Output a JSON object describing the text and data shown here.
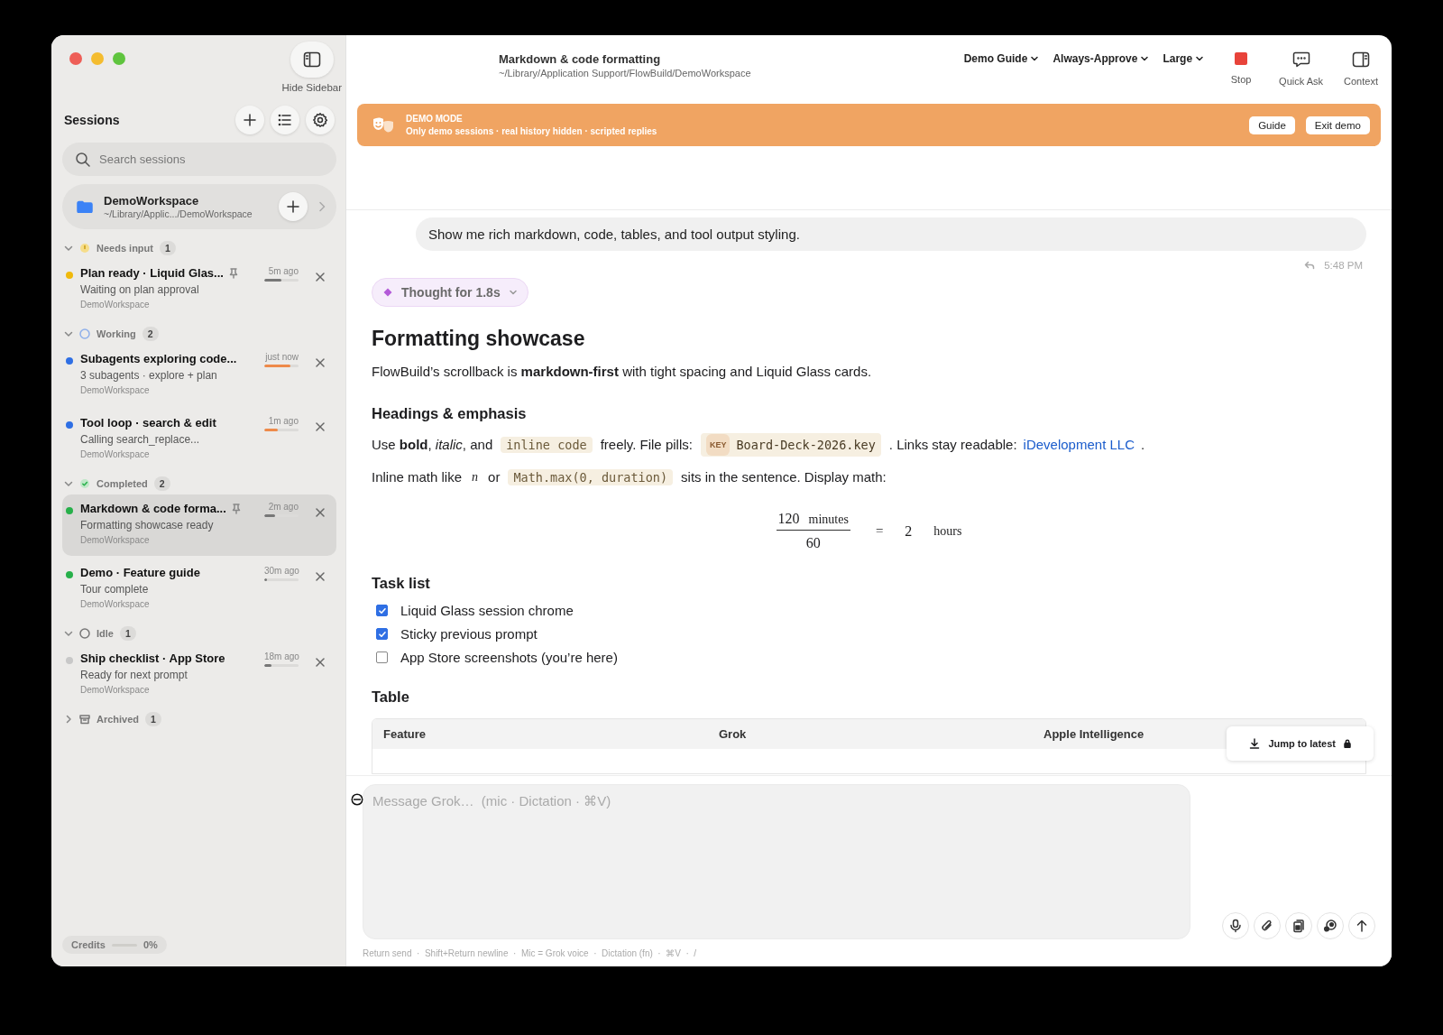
{
  "sidebar": {
    "hide_button": {
      "label": "Hide Sidebar"
    },
    "title": "Sessions",
    "search": {
      "placeholder": "Search sessions"
    },
    "workspace": {
      "name": "DemoWorkspace",
      "path": "~/Library/Applic.../DemoWorkspace"
    },
    "groups": [
      {
        "kind": "needs_input",
        "label": "Needs input",
        "count": "1",
        "expanded": true,
        "items": [
          {
            "title": "Plan ready · Liquid Glas...",
            "pinned": true,
            "subtitle": "Waiting on plan approval",
            "workspace": "DemoWorkspace",
            "time": "5m ago",
            "level": 0.5,
            "color": "#f0b90b",
            "selected": false
          }
        ]
      },
      {
        "kind": "working",
        "label": "Working",
        "count": "2",
        "expanded": true,
        "items": [
          {
            "title": "Subagents exploring code...",
            "pinned": false,
            "subtitle": "3 subagents · explore + plan",
            "workspace": "DemoWorkspace",
            "time": "just now",
            "level": 0.75,
            "color": "#2f6fe4",
            "selected": false
          },
          {
            "title": "Tool loop · search & edit",
            "pinned": false,
            "subtitle": "Calling search_replace...",
            "workspace": "DemoWorkspace",
            "time": "1m ago",
            "level": 0.4,
            "color": "#2f6fe4",
            "selected": false
          }
        ]
      },
      {
        "kind": "completed",
        "label": "Completed",
        "count": "2",
        "expanded": true,
        "items": [
          {
            "title": "Markdown & code forma...",
            "pinned": true,
            "subtitle": "Formatting showcase ready",
            "workspace": "DemoWorkspace",
            "time": "2m ago",
            "level": 0.32,
            "color": "#27b04a",
            "selected": true
          },
          {
            "title": "Demo · Feature guide",
            "pinned": false,
            "subtitle": "Tour complete",
            "workspace": "DemoWorkspace",
            "time": "30m ago",
            "level": 0.08,
            "color": "#27b04a",
            "selected": false
          }
        ]
      },
      {
        "kind": "idle",
        "label": "Idle",
        "count": "1",
        "expanded": true,
        "items": [
          {
            "title": "Ship checklist · App Store",
            "pinned": false,
            "subtitle": "Ready for next prompt",
            "workspace": "DemoWorkspace",
            "time": "18m ago",
            "level": 0.22,
            "color": "#c8c8c8",
            "selected": false
          }
        ]
      },
      {
        "kind": "archived",
        "label": "Archived",
        "count": "1",
        "expanded": false
      }
    ],
    "credits": {
      "label": "Credits",
      "level": 0,
      "reading": "0%"
    }
  },
  "header": {
    "title": "Markdown & code formatting",
    "path": "~/Library/Application Support/FlowBuild/DemoWorkspace",
    "dropdowns": [
      "Demo Guide",
      "Always-Approve",
      "Large"
    ],
    "tools": [
      {
        "kind": "stop",
        "label": "Stop"
      },
      {
        "kind": "quick_ask",
        "label": "Quick Ask"
      },
      {
        "kind": "context",
        "label": "Context"
      }
    ]
  },
  "banner": {
    "title": "DEMO MODE",
    "text": "Only demo sessions · real history hidden · scripted replies",
    "buttons": [
      "Guide",
      "Exit demo"
    ]
  },
  "conversation": {
    "user_message": "Show me rich markdown, code, tables, and tool output styling.",
    "time": "5:48 PM",
    "thought": "Thought for 1.8s",
    "blocks": [
      {
        "kind": "h1",
        "text": "Formatting showcase"
      },
      {
        "kind": "para",
        "segments": [
          {
            "kind": "text",
            "text": "FlowBuild’s scrollback is **markdown-first** with tight spacing and Liquid Glass cards."
          }
        ]
      },
      {
        "kind": "h2",
        "text": "Headings & emphasis"
      },
      {
        "kind": "para",
        "segments": [
          {
            "kind": "text",
            "text": "Use **bold**, *italic*, and"
          },
          {
            "kind": "code",
            "text": "inline code"
          },
          {
            "kind": "text",
            "text": "freely. File pills:"
          },
          {
            "kind": "file",
            "tag": "KEY",
            "text": "Board-Deck-2026.key"
          },
          {
            "kind": "text",
            "text": ". Links stay readable:"
          },
          {
            "kind": "link",
            "text": "iDevelopment LLC"
          },
          {
            "kind": "text",
            "text": "."
          }
        ]
      },
      {
        "kind": "para",
        "segments": [
          {
            "kind": "text",
            "text": "Inline math like"
          },
          {
            "kind": "math",
            "text": "n"
          },
          {
            "kind": "text",
            "text": "or"
          },
          {
            "kind": "code",
            "text": "Math.max(0, duration)"
          },
          {
            "kind": "text",
            "text": "sits in the sentence. Display math:"
          }
        ]
      },
      {
        "kind": "math",
        "numerator": "120",
        "numerator_unit": "minutes",
        "denominator": "60",
        "equals": "=",
        "result": "2",
        "result_unit": "hours"
      },
      {
        "kind": "h2",
        "text": "Task list"
      },
      {
        "kind": "tasks",
        "items": [
          {
            "text": "Liquid Glass session chrome",
            "checked": true
          },
          {
            "text": "Sticky previous prompt",
            "checked": true
          },
          {
            "text": "App Store screenshots (you’re here)",
            "checked": false
          }
        ]
      },
      {
        "kind": "h2",
        "text": "Table"
      },
      {
        "kind": "table",
        "columns": [
          "Feature",
          "Grok",
          "Apple Intelligence"
        ]
      }
    ],
    "jump_button": "Jump to latest"
  },
  "composer": {
    "placeholder": "Message Grok…  (mic · Dictation · ⌘V)",
    "hint": "Return send  ·  Shift+Return newline  ·  Mic = Grok voice  ·  Dictation (fn)  ·  ⌘V  ·  /"
  }
}
